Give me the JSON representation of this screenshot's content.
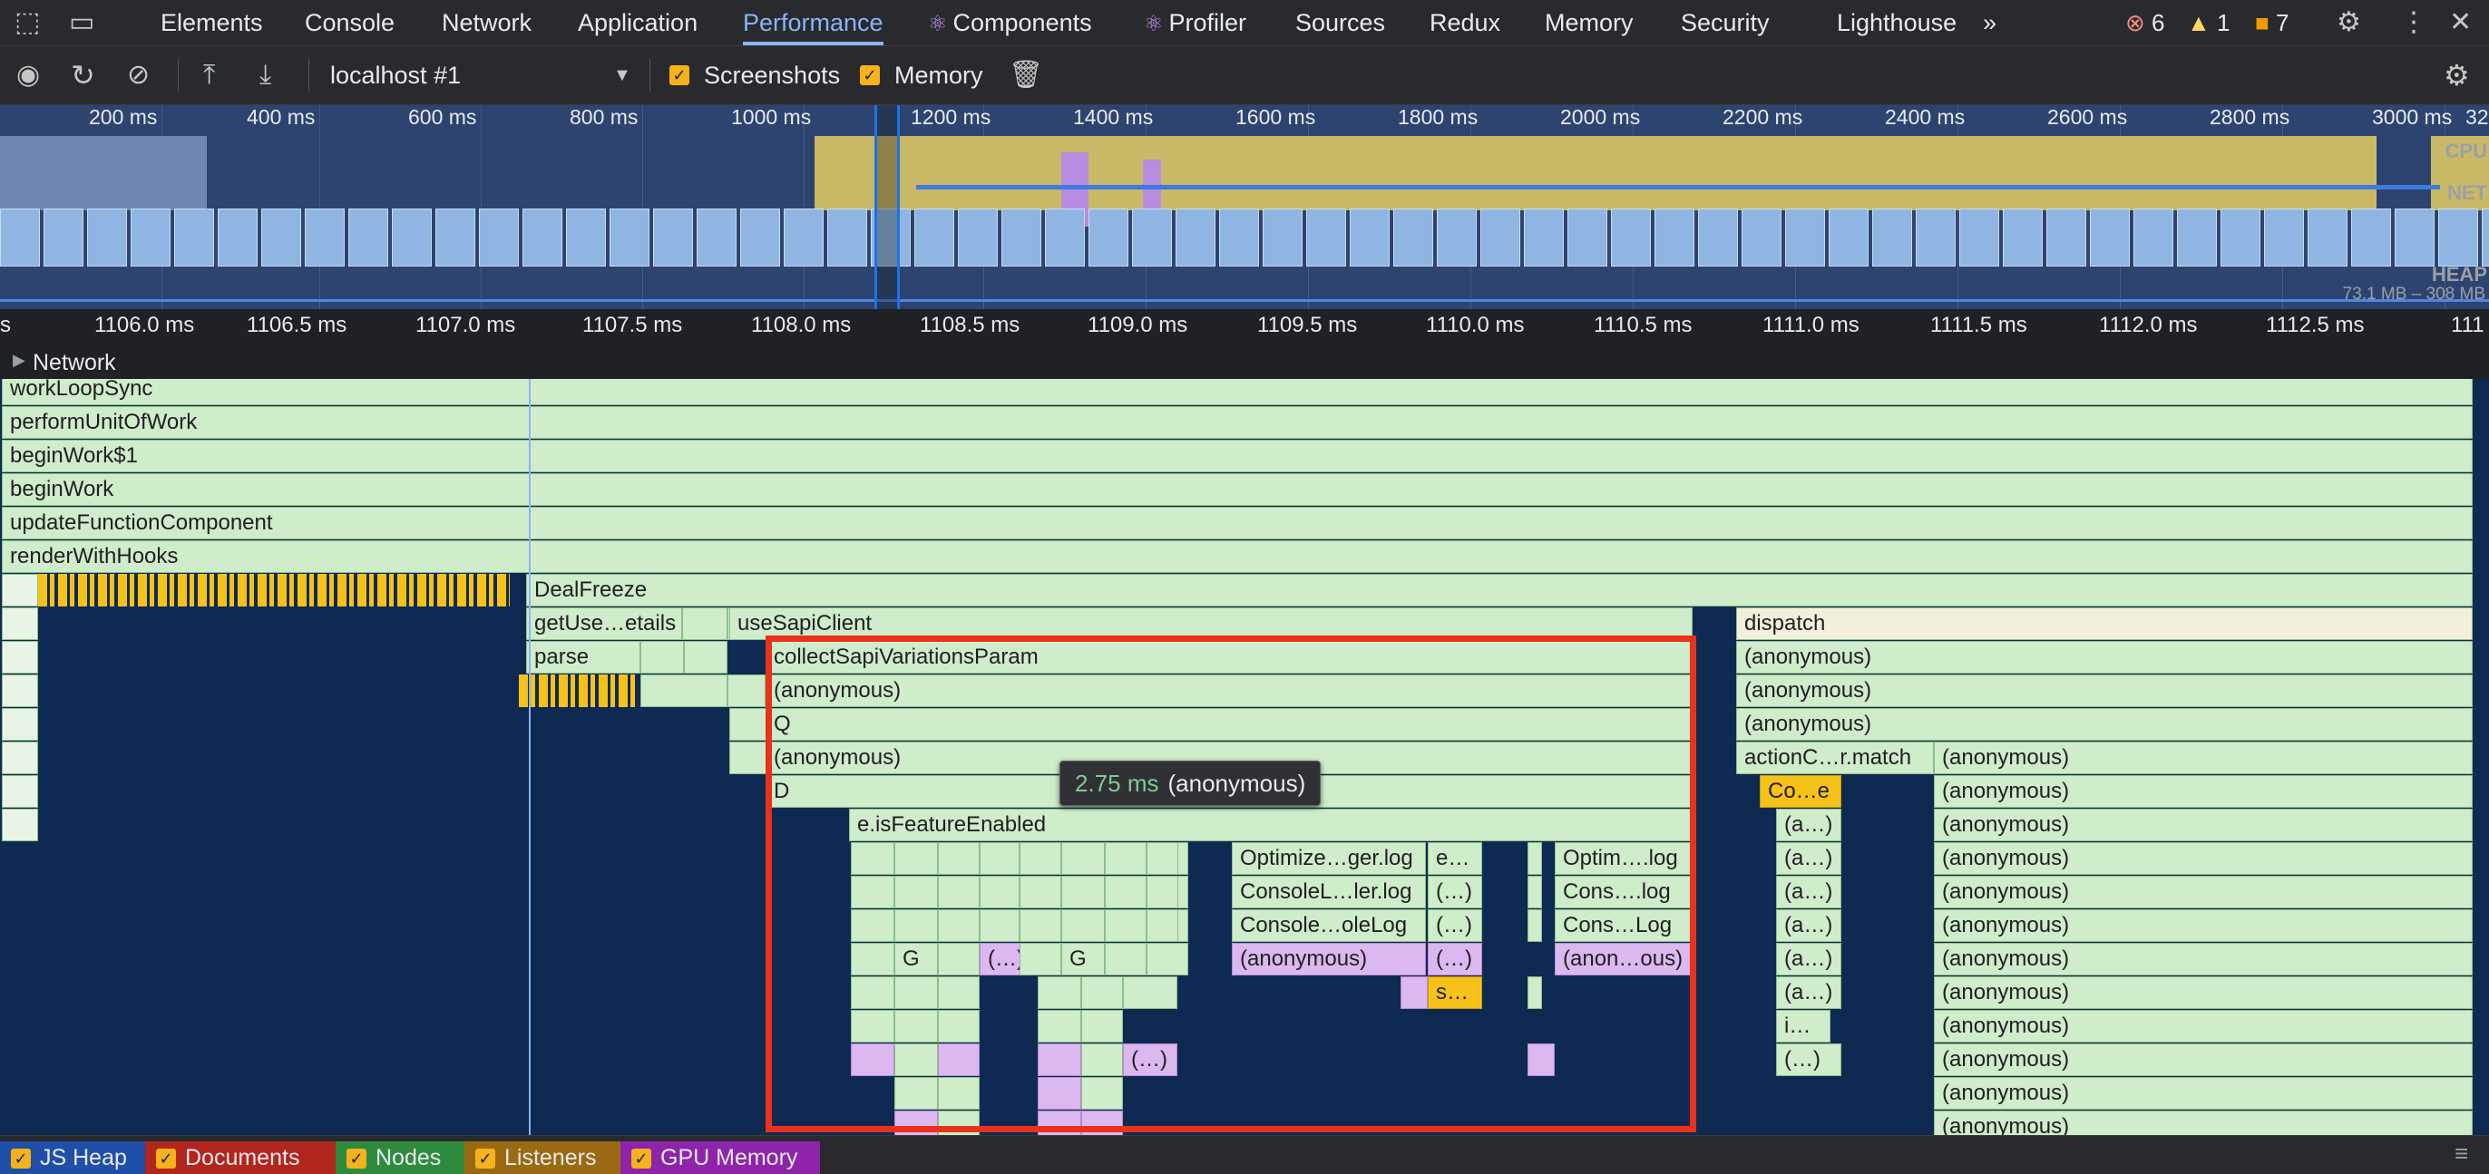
{
  "tabs": {
    "items": [
      "Elements",
      "Console",
      "Network",
      "Application",
      "Performance",
      "Components",
      "Profiler",
      "Sources",
      "Redux",
      "Memory",
      "Security",
      "Lighthouse"
    ],
    "more": "»"
  },
  "issues": {
    "errors": "6",
    "warnings": "1",
    "info": "7"
  },
  "toolbar": {
    "target": "localhost #1",
    "screenshots_label": "Screenshots",
    "memory_label": "Memory"
  },
  "overview": {
    "ticks": [
      "200 ms",
      "400 ms",
      "600 ms",
      "800 ms",
      "1000 ms",
      "1200 ms",
      "1400 ms",
      "1600 ms",
      "1800 ms",
      "2000 ms",
      "2200 ms",
      "2400 ms",
      "2600 ms",
      "2800 ms",
      "3000 ms",
      "32"
    ],
    "cpu_label": "CPU",
    "net_label": "NET",
    "heap_label": "HEAP",
    "heap_range": "73.1 MB – 308 MB"
  },
  "ruler": {
    "ticks": [
      "s",
      "1106.0 ms",
      "1106.5 ms",
      "1107.0 ms",
      "1107.5 ms",
      "1108.0 ms",
      "1108.5 ms",
      "1109.0 ms",
      "1109.5 ms",
      "1110.0 ms",
      "1110.5 ms",
      "1111.0 ms",
      "1111.5 ms",
      "1112.0 ms",
      "1112.5 ms",
      "111"
    ]
  },
  "network_row": {
    "label": "Network"
  },
  "flame": {
    "stack": [
      "workLoopSync",
      "performUnitOfWork",
      "beginWork$1",
      "beginWork",
      "updateFunctionComponent",
      "renderWithHooks"
    ],
    "calls": [
      "DealFreeze",
      "getUse…etails",
      "useSapiClient",
      "dispatch",
      "parse",
      "collectSapiVariationsParam",
      "(anonymous)",
      "Q",
      "D",
      "e.isFeatureEnabled",
      "actionC…r.match",
      "Co…e",
      "(a…)",
      "G",
      "(…)",
      "Optimize…ger.log",
      "ConsoleL…ler.log",
      "Console…oleLog",
      "e…",
      "s…",
      "Optim….log",
      "Cons….log",
      "Cons…Log",
      "(anon…ous)",
      "i…"
    ]
  },
  "tooltip": {
    "duration": "2.75 ms",
    "name": "(anonymous)"
  },
  "bottom": [
    "JS Heap",
    "Documents",
    "Nodes",
    "Listeners",
    "GPU Memory"
  ],
  "colors": {
    "accent": "#8ab4f8",
    "flame_green": "#cfeccb",
    "flame_purple": "#dcb8f0",
    "flame_yellow": "#f6c21a",
    "highlight": "#e8321b",
    "bottom_js_heap": "#1f4fa8",
    "bottom_documents": "#b3261e",
    "bottom_nodes": "#2e8b3d",
    "bottom_listeners": "#9a6a12",
    "bottom_gpu": "#8e24aa"
  }
}
